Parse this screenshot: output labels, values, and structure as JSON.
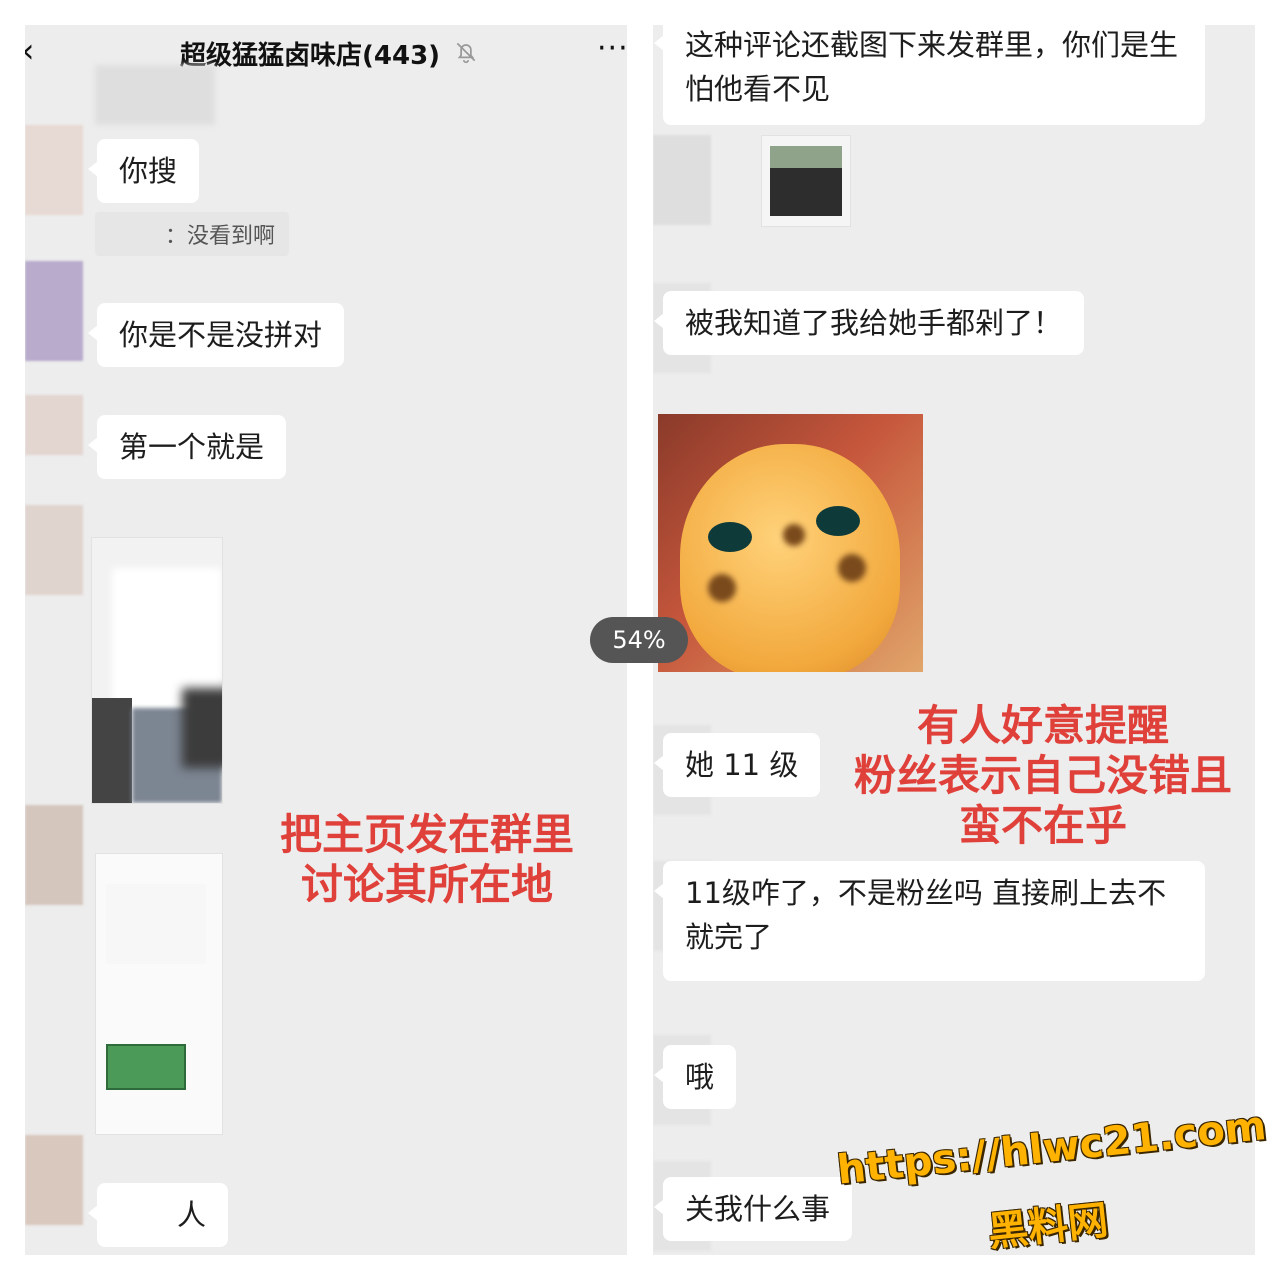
{
  "left": {
    "header": {
      "back_icon": "‹",
      "title": "超级猛猛卤味店(443)",
      "mute_icon": "bell-muted-icon",
      "more_icon": "···"
    },
    "messages": [
      {
        "type": "text",
        "text": "你搜"
      },
      {
        "type": "system",
        "text": "：没看到啊"
      },
      {
        "type": "text",
        "text": "你是不是没拼对"
      },
      {
        "type": "text",
        "text": "第一个就是"
      },
      {
        "type": "image"
      },
      {
        "type": "image"
      },
      {
        "type": "text",
        "text": "人"
      }
    ],
    "annotation": [
      "把主页发在群里",
      "讨论其所在地"
    ]
  },
  "right": {
    "messages": [
      {
        "type": "text",
        "text": "这种评论还截图下来发群里，你们是生怕他看不见"
      },
      {
        "type": "image"
      },
      {
        "type": "text",
        "text": "被我知道了我给她手都剁了！"
      },
      {
        "type": "sticker"
      },
      {
        "type": "text",
        "text": "她 11 级"
      },
      {
        "type": "text",
        "text": "11级咋了，不是粉丝吗 直接刷上去不就完了"
      },
      {
        "type": "text",
        "text": "哦"
      },
      {
        "type": "text",
        "text": "关我什么事"
      }
    ],
    "annotation": [
      "有人好意提醒",
      "粉丝表示自己没错且",
      "蛮不在乎"
    ]
  },
  "overlay": {
    "progress_label": "54%",
    "watermark_url": "https://hlwc21.com",
    "watermark_name": "黑料网"
  },
  "colors": {
    "background": "#ededed",
    "bubble": "#ffffff",
    "annotation": "#e0403a",
    "watermark": "#ffb300"
  }
}
